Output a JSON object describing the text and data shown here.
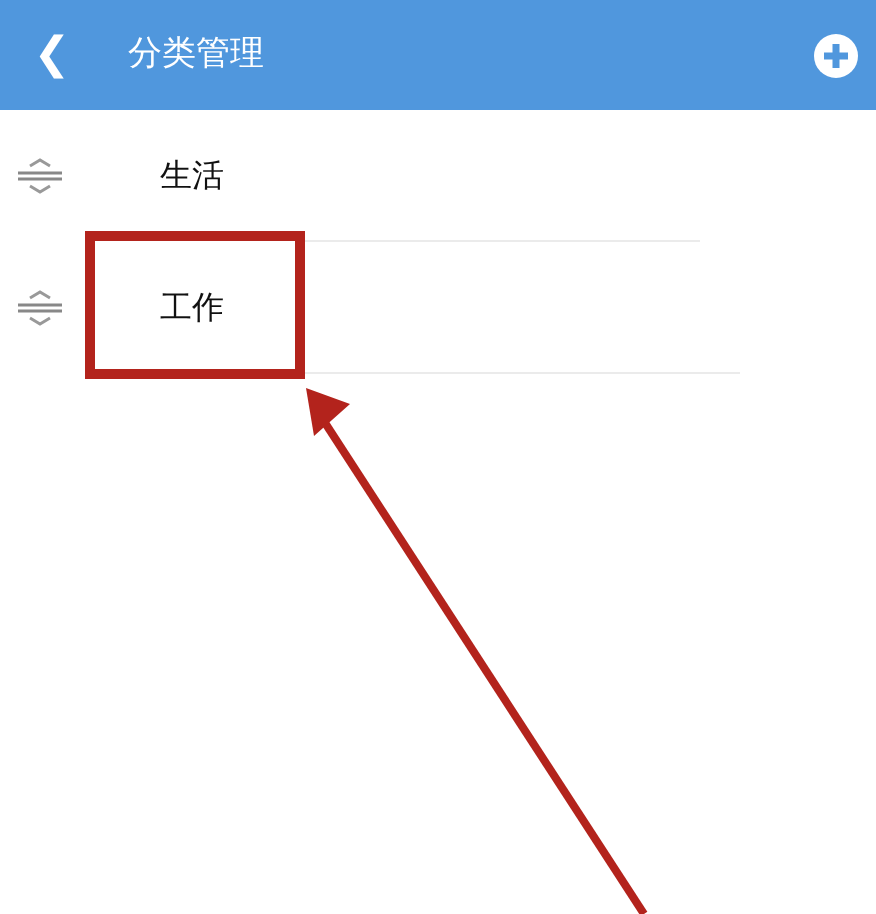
{
  "header": {
    "back": "❮",
    "title": "分类管理"
  },
  "categories": [
    {
      "label": "生活",
      "highlighted": false
    },
    {
      "label": "工作",
      "highlighted": true
    }
  ]
}
